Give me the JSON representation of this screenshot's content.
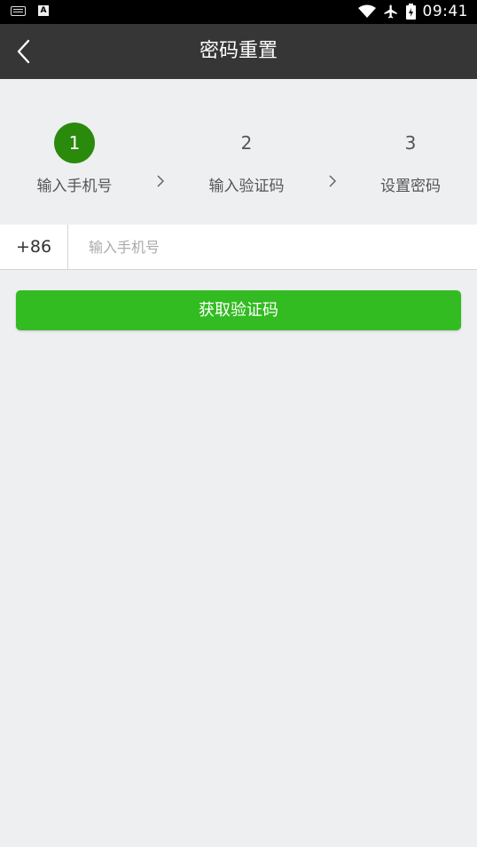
{
  "status_bar": {
    "time": "09:41"
  },
  "app_bar": {
    "title": "密码重置"
  },
  "steps": [
    {
      "number": "1",
      "label": "输入手机号",
      "active": true
    },
    {
      "number": "2",
      "label": "输入验证码",
      "active": false
    },
    {
      "number": "3",
      "label": "设置密码",
      "active": false
    }
  ],
  "phone_form": {
    "country_code": "+86",
    "placeholder": "输入手机号",
    "value": ""
  },
  "get_code_button": {
    "label": "获取验证码"
  },
  "colors": {
    "app_bar_bg": "#363636",
    "active_step": "#2a8a0c",
    "primary_button": "#33bb22",
    "page_bg": "#eeeff1"
  }
}
